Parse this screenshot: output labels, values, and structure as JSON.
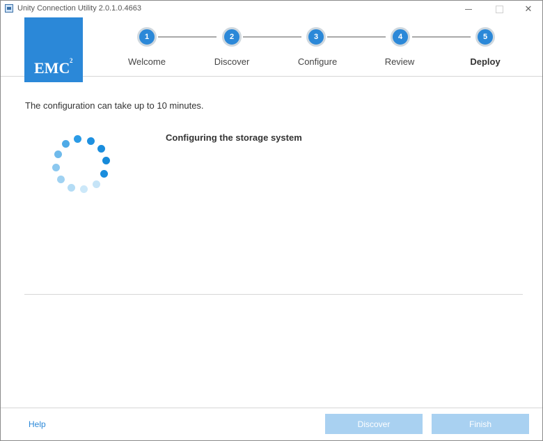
{
  "window": {
    "title": "Unity Connection Utility  2.0.1.0.4663",
    "minimize_label": "–",
    "close_label": "✕"
  },
  "header": {
    "logo": "EMC",
    "logo_sup": "2",
    "steps": [
      {
        "number": "1",
        "label": "Welcome",
        "active": false
      },
      {
        "number": "2",
        "label": "Discover",
        "active": false
      },
      {
        "number": "3",
        "label": "Configure",
        "active": false
      },
      {
        "number": "4",
        "label": "Review",
        "active": false
      },
      {
        "number": "5",
        "label": "Deploy",
        "active": true
      }
    ]
  },
  "content": {
    "info_text": "The configuration can take up to 10 minutes.",
    "status_text": "Configuring the storage system"
  },
  "footer": {
    "help_label": "Help",
    "discover_label": "Discover",
    "finish_label": "Finish"
  },
  "colors": {
    "accent": "#2b88d8",
    "disabled_button": "#a9d1f1"
  }
}
